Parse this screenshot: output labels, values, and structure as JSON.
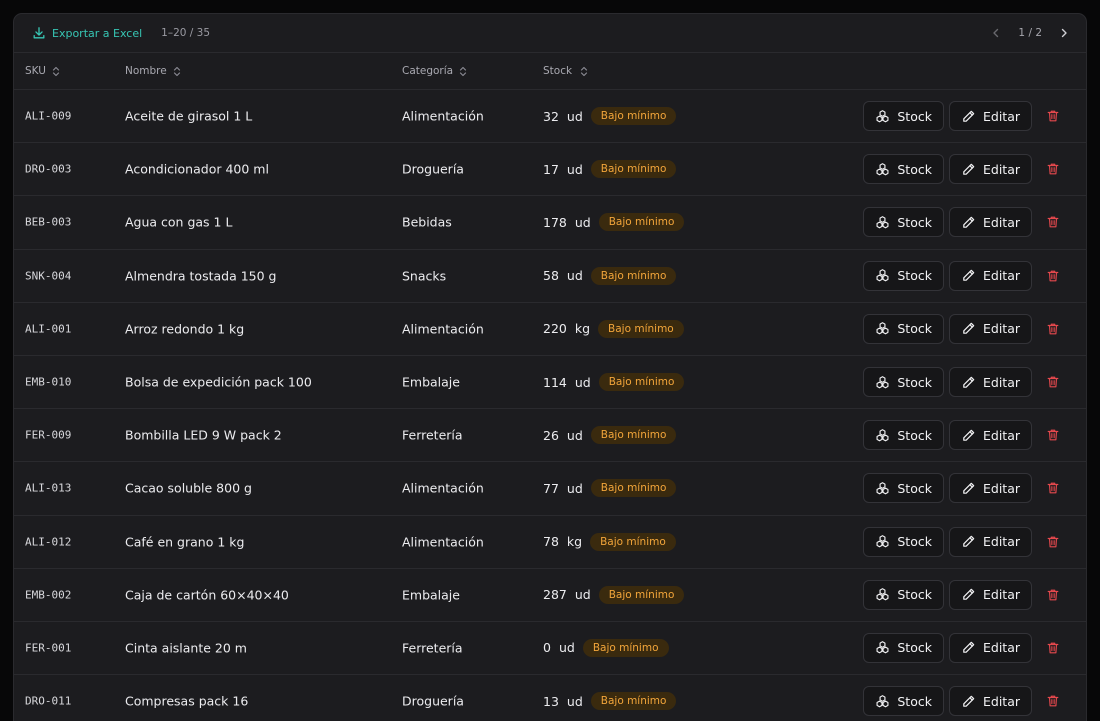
{
  "toolbar": {
    "export_label": "Exportar a Excel",
    "range_label": "1–20 / 35",
    "page_label": "1 / 2"
  },
  "columns": {
    "sku": "SKU",
    "name": "Nombre",
    "category": "Categoría",
    "stock": "Stock"
  },
  "actions": {
    "stock_label": "Stock",
    "edit_label": "Editar"
  },
  "colors": {
    "accent": "#37c6b4",
    "badge_bg": "#3a2a0e",
    "badge_text": "#f2a53a",
    "danger": "#e5484d"
  },
  "rows": [
    {
      "sku": "ALI-009",
      "name": "Aceite de girasol 1 L",
      "category": "Alimentación",
      "qty": "32",
      "unit": "ud",
      "badge": "Bajo mínimo"
    },
    {
      "sku": "DRO-003",
      "name": "Acondicionador 400 ml",
      "category": "Droguería",
      "qty": "17",
      "unit": "ud",
      "badge": "Bajo mínimo"
    },
    {
      "sku": "BEB-003",
      "name": "Agua con gas 1 L",
      "category": "Bebidas",
      "qty": "178",
      "unit": "ud",
      "badge": "Bajo mínimo"
    },
    {
      "sku": "SNK-004",
      "name": "Almendra tostada 150 g",
      "category": "Snacks",
      "qty": "58",
      "unit": "ud",
      "badge": "Bajo mínimo"
    },
    {
      "sku": "ALI-001",
      "name": "Arroz redondo 1 kg",
      "category": "Alimentación",
      "qty": "220",
      "unit": "kg",
      "badge": "Bajo mínimo"
    },
    {
      "sku": "EMB-010",
      "name": "Bolsa de expedición pack 100",
      "category": "Embalaje",
      "qty": "114",
      "unit": "ud",
      "badge": "Bajo mínimo"
    },
    {
      "sku": "FER-009",
      "name": "Bombilla LED 9 W pack 2",
      "category": "Ferretería",
      "qty": "26",
      "unit": "ud",
      "badge": "Bajo mínimo"
    },
    {
      "sku": "ALI-013",
      "name": "Cacao soluble 800 g",
      "category": "Alimentación",
      "qty": "77",
      "unit": "ud",
      "badge": "Bajo mínimo"
    },
    {
      "sku": "ALI-012",
      "name": "Café en grano 1 kg",
      "category": "Alimentación",
      "qty": "78",
      "unit": "kg",
      "badge": "Bajo mínimo"
    },
    {
      "sku": "EMB-002",
      "name": "Caja de cartón 60×40×40",
      "category": "Embalaje",
      "qty": "287",
      "unit": "ud",
      "badge": "Bajo mínimo"
    },
    {
      "sku": "FER-001",
      "name": "Cinta aislante 20 m",
      "category": "Ferretería",
      "qty": "0",
      "unit": "ud",
      "badge": "Bajo mínimo"
    },
    {
      "sku": "DRO-011",
      "name": "Compresas pack 16",
      "category": "Droguería",
      "qty": "13",
      "unit": "ud",
      "badge": "Bajo mínimo"
    }
  ]
}
